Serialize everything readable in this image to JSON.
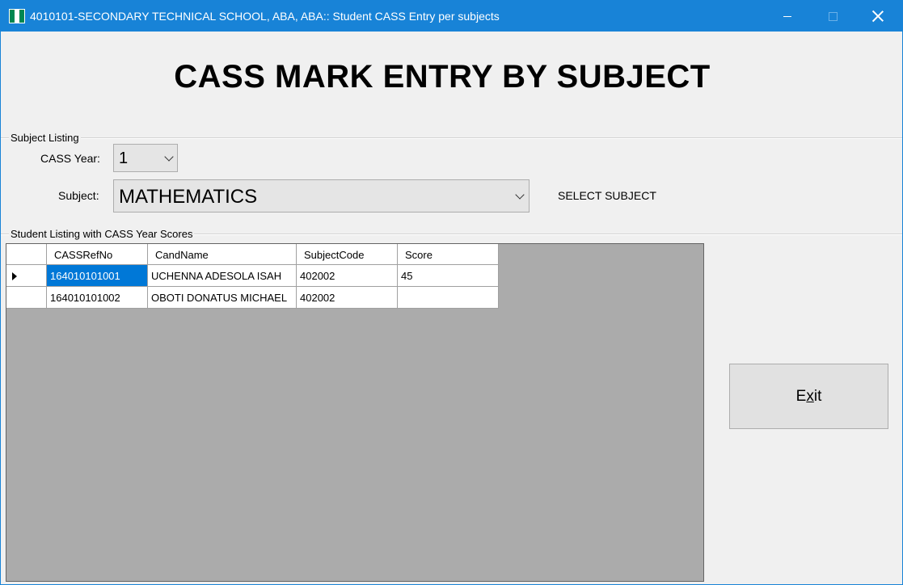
{
  "window": {
    "title": "4010101-SECONDARY TECHNICAL SCHOOL, ABA, ABA:: Student CASS Entry per subjects"
  },
  "heading": "CASS MARK ENTRY BY SUBJECT",
  "subject_listing": {
    "group_label": "Subject Listing",
    "cass_year_label": "CASS Year:",
    "cass_year_value": "1",
    "subject_label": "Subject:",
    "subject_value": "MATHEMATICS",
    "hint": "SELECT SUBJECT"
  },
  "student_listing": {
    "group_label": "Student Listing with CASS Year Scores",
    "columns": [
      "CASSRefNo",
      "CandName",
      "SubjectCode",
      "Score"
    ],
    "rows": [
      {
        "ref": "164010101001",
        "name": "UCHENNA ADESOLA ISAH",
        "code": "402002",
        "score": "45"
      },
      {
        "ref": "164010101002",
        "name": "OBOTI DONATUS MICHAEL",
        "code": "402002",
        "score": ""
      }
    ]
  },
  "exit_button": {
    "pre": "E",
    "accel": "x",
    "post": "it"
  },
  "colors": {
    "titlebar": "#1883d7",
    "selection": "#0078d7",
    "grid_background": "#ababab"
  }
}
